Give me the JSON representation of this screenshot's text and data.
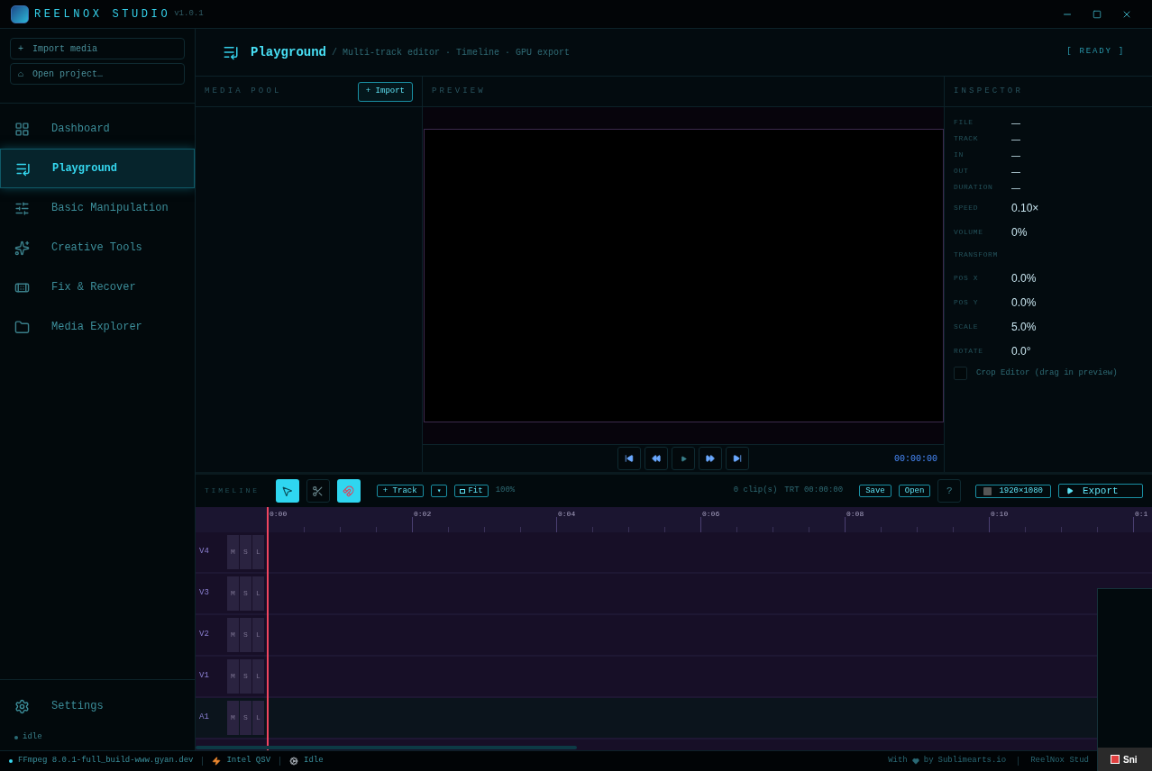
{
  "app": {
    "name": "REELNOX STUDIO",
    "version": "v1.0.1"
  },
  "sidebar": {
    "actions": [
      {
        "icon": "+",
        "label": "Import media"
      },
      {
        "icon": "⌂",
        "label": "Open project…"
      }
    ],
    "items": [
      {
        "kind": "dashboard",
        "label": "Dashboard",
        "selected": false
      },
      {
        "kind": "playground",
        "label": "Playground",
        "selected": true
      },
      {
        "kind": "manipulation",
        "label": "Basic Manipulation",
        "selected": false
      },
      {
        "kind": "creative",
        "label": "Creative Tools",
        "selected": false
      },
      {
        "kind": "fix",
        "label": "Fix & Recover",
        "selected": false
      },
      {
        "kind": "explorer",
        "label": "Media Explorer",
        "selected": false
      }
    ],
    "settings": "Settings",
    "status": "idle"
  },
  "header": {
    "title": "Playground",
    "separator": "/",
    "subtitle": "Multi-track editor · Timeline · GPU export",
    "status": "[ READY ]"
  },
  "media_pool": {
    "title": "MEDIA POOL",
    "import_button": "+ Import"
  },
  "preview": {
    "title": "PREVIEW",
    "timecode": "00:00:00"
  },
  "inspector": {
    "title": "INSPECTOR",
    "fields": [
      {
        "kind": "info",
        "label": "FILE",
        "value": "—"
      },
      {
        "kind": "info",
        "label": "TRACK",
        "value": "—"
      },
      {
        "kind": "info",
        "label": "IN",
        "value": "—"
      },
      {
        "kind": "info",
        "label": "OUT",
        "value": "—"
      },
      {
        "kind": "info",
        "label": "DURATION",
        "value": "—"
      },
      {
        "kind": "param",
        "label": "SPEED",
        "value": "0.10×"
      },
      {
        "kind": "param",
        "label": "VOLUME",
        "value": "0%"
      },
      {
        "kind": "heading",
        "label": "TRANSFORM"
      },
      {
        "kind": "param",
        "label": "POS X",
        "value": "0.0%"
      },
      {
        "kind": "param",
        "label": "POS Y",
        "value": "0.0%"
      },
      {
        "kind": "param",
        "label": "SCALE",
        "value": "5.0%"
      },
      {
        "kind": "param",
        "label": "ROTATE",
        "value": "0.0°"
      }
    ],
    "crop_editor": {
      "label": "Crop Editor (drag in preview)",
      "checked": false
    }
  },
  "timeline": {
    "title": "TIMELINE",
    "tools": [
      {
        "kind": "select",
        "selected": true
      },
      {
        "kind": "cut",
        "selected": false
      },
      {
        "kind": "snap",
        "selected": true
      }
    ],
    "add_track": "+ Track",
    "dropdown": "▾",
    "fit": "Fit",
    "zoom": "100%",
    "clip_count": "0 clip(s)",
    "trt": "TRT 00:00:00",
    "save": "Save",
    "open": "Open",
    "help": "?",
    "resolution": "1920×1080",
    "export": "Export",
    "ruler": [
      "0:00",
      "0:02",
      "0:04",
      "0:06",
      "0:08",
      "0:10",
      "0:1"
    ],
    "tracks": [
      {
        "name": "V4",
        "buttons": [
          "M",
          "S",
          "L"
        ]
      },
      {
        "name": "V3",
        "buttons": [
          "M",
          "S",
          "L"
        ]
      },
      {
        "name": "V2",
        "buttons": [
          "M",
          "S",
          "L"
        ]
      },
      {
        "name": "V1",
        "buttons": [
          "M",
          "S",
          "L"
        ]
      },
      {
        "name": "A1",
        "buttons": [
          "M",
          "S",
          "L"
        ]
      }
    ]
  },
  "status_bar": {
    "items": [
      {
        "kind": "engine",
        "text": "FFmpeg 8.0.1-full_build-www.gyan.dev"
      },
      {
        "kind": "hardware",
        "text": "Intel QSV"
      },
      {
        "kind": "state",
        "text": "Idle"
      }
    ],
    "credit_prefix": "With",
    "credit_by": "by",
    "credit_brand": "Sublimearts.io",
    "app_label": "ReelNox Stud"
  },
  "thumbnail": {
    "caption": "Sni"
  }
}
